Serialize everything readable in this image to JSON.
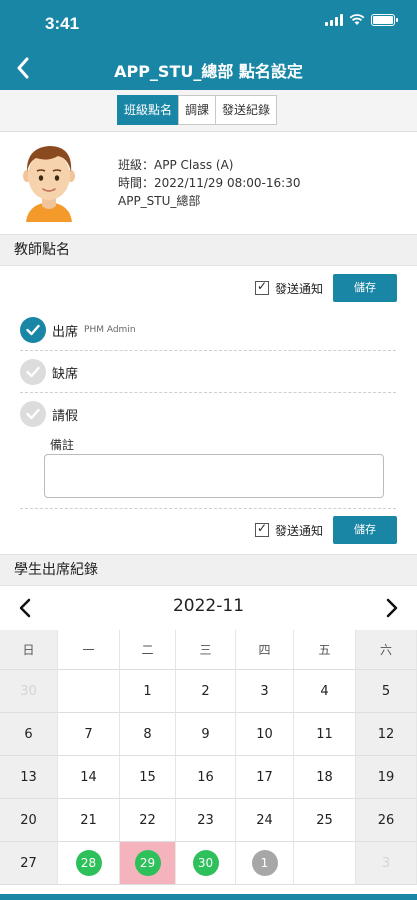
{
  "status": {
    "time": "3:41"
  },
  "header": {
    "title": "APP_STU_總部 點名設定"
  },
  "tabs": [
    {
      "label": "班級點名",
      "active": true
    },
    {
      "label": "調課",
      "active": false
    },
    {
      "label": "發送紀錄",
      "active": false
    }
  ],
  "info": {
    "class_line": "班級：APP Class (A)",
    "time_line": "時間：2022/11/29 08:00-16:30",
    "branch_line": "APP_STU_總部"
  },
  "teacher_section": {
    "title": "教師點名"
  },
  "notify": {
    "label": "發送通知",
    "checked": true,
    "save_label": "儲存"
  },
  "attendance_options": [
    {
      "label": "出席",
      "sub": "PHM Admin",
      "selected": true
    },
    {
      "label": "缺席",
      "sub": "",
      "selected": false
    },
    {
      "label": "請假",
      "sub": "",
      "selected": false
    }
  ],
  "remark": {
    "label": "備註",
    "value": ""
  },
  "student_section": {
    "title": "學生出席紀錄"
  },
  "calendar": {
    "month": "2022-11",
    "weekdays": [
      "日",
      "一",
      "二",
      "三",
      "四",
      "五",
      "六"
    ],
    "weeks": [
      [
        {
          "d": "30",
          "out": true
        },
        {
          "d": ""
        },
        {
          "d": "1"
        },
        {
          "d": "2"
        },
        {
          "d": "3"
        },
        {
          "d": "4"
        },
        {
          "d": "5"
        }
      ],
      [
        {
          "d": "6"
        },
        {
          "d": "7"
        },
        {
          "d": "8"
        },
        {
          "d": "9"
        },
        {
          "d": "10"
        },
        {
          "d": "11"
        },
        {
          "d": "12"
        }
      ],
      [
        {
          "d": "13"
        },
        {
          "d": "14"
        },
        {
          "d": "15"
        },
        {
          "d": "16"
        },
        {
          "d": "17"
        },
        {
          "d": "18"
        },
        {
          "d": "19"
        }
      ],
      [
        {
          "d": "20"
        },
        {
          "d": "21"
        },
        {
          "d": "22"
        },
        {
          "d": "23"
        },
        {
          "d": "24"
        },
        {
          "d": "25"
        },
        {
          "d": "26"
        }
      ],
      [
        {
          "d": "27"
        },
        {
          "d": "28",
          "mark": "present"
        },
        {
          "d": "29",
          "mark": "present",
          "selected": true
        },
        {
          "d": "30",
          "mark": "present"
        },
        {
          "d": "1",
          "mark": "none"
        },
        {
          "d": ""
        },
        {
          "d": "3",
          "out": true
        }
      ]
    ],
    "colors": {
      "present": "#2ec05a",
      "none": "#a7a7a7",
      "selected_bg": "#f4b3bd",
      "accent": "#1a86a6"
    }
  }
}
